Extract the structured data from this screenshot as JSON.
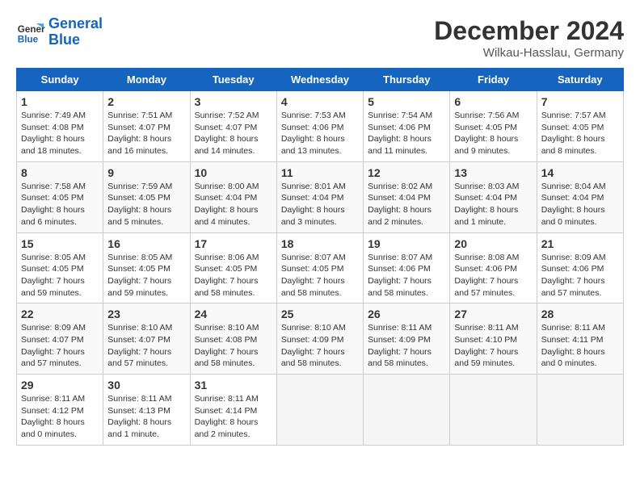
{
  "header": {
    "logo_line1": "General",
    "logo_line2": "Blue",
    "month": "December 2024",
    "location": "Wilkau-Hasslau, Germany"
  },
  "days_of_week": [
    "Sunday",
    "Monday",
    "Tuesday",
    "Wednesday",
    "Thursday",
    "Friday",
    "Saturday"
  ],
  "weeks": [
    [
      {
        "num": "1",
        "detail": "Sunrise: 7:49 AM\nSunset: 4:08 PM\nDaylight: 8 hours\nand 18 minutes."
      },
      {
        "num": "2",
        "detail": "Sunrise: 7:51 AM\nSunset: 4:07 PM\nDaylight: 8 hours\nand 16 minutes."
      },
      {
        "num": "3",
        "detail": "Sunrise: 7:52 AM\nSunset: 4:07 PM\nDaylight: 8 hours\nand 14 minutes."
      },
      {
        "num": "4",
        "detail": "Sunrise: 7:53 AM\nSunset: 4:06 PM\nDaylight: 8 hours\nand 13 minutes."
      },
      {
        "num": "5",
        "detail": "Sunrise: 7:54 AM\nSunset: 4:06 PM\nDaylight: 8 hours\nand 11 minutes."
      },
      {
        "num": "6",
        "detail": "Sunrise: 7:56 AM\nSunset: 4:05 PM\nDaylight: 8 hours\nand 9 minutes."
      },
      {
        "num": "7",
        "detail": "Sunrise: 7:57 AM\nSunset: 4:05 PM\nDaylight: 8 hours\nand 8 minutes."
      }
    ],
    [
      {
        "num": "8",
        "detail": "Sunrise: 7:58 AM\nSunset: 4:05 PM\nDaylight: 8 hours\nand 6 minutes."
      },
      {
        "num": "9",
        "detail": "Sunrise: 7:59 AM\nSunset: 4:05 PM\nDaylight: 8 hours\nand 5 minutes."
      },
      {
        "num": "10",
        "detail": "Sunrise: 8:00 AM\nSunset: 4:04 PM\nDaylight: 8 hours\nand 4 minutes."
      },
      {
        "num": "11",
        "detail": "Sunrise: 8:01 AM\nSunset: 4:04 PM\nDaylight: 8 hours\nand 3 minutes."
      },
      {
        "num": "12",
        "detail": "Sunrise: 8:02 AM\nSunset: 4:04 PM\nDaylight: 8 hours\nand 2 minutes."
      },
      {
        "num": "13",
        "detail": "Sunrise: 8:03 AM\nSunset: 4:04 PM\nDaylight: 8 hours\nand 1 minute."
      },
      {
        "num": "14",
        "detail": "Sunrise: 8:04 AM\nSunset: 4:04 PM\nDaylight: 8 hours\nand 0 minutes."
      }
    ],
    [
      {
        "num": "15",
        "detail": "Sunrise: 8:05 AM\nSunset: 4:05 PM\nDaylight: 7 hours\nand 59 minutes."
      },
      {
        "num": "16",
        "detail": "Sunrise: 8:05 AM\nSunset: 4:05 PM\nDaylight: 7 hours\nand 59 minutes."
      },
      {
        "num": "17",
        "detail": "Sunrise: 8:06 AM\nSunset: 4:05 PM\nDaylight: 7 hours\nand 58 minutes."
      },
      {
        "num": "18",
        "detail": "Sunrise: 8:07 AM\nSunset: 4:05 PM\nDaylight: 7 hours\nand 58 minutes."
      },
      {
        "num": "19",
        "detail": "Sunrise: 8:07 AM\nSunset: 4:06 PM\nDaylight: 7 hours\nand 58 minutes."
      },
      {
        "num": "20",
        "detail": "Sunrise: 8:08 AM\nSunset: 4:06 PM\nDaylight: 7 hours\nand 57 minutes."
      },
      {
        "num": "21",
        "detail": "Sunrise: 8:09 AM\nSunset: 4:06 PM\nDaylight: 7 hours\nand 57 minutes."
      }
    ],
    [
      {
        "num": "22",
        "detail": "Sunrise: 8:09 AM\nSunset: 4:07 PM\nDaylight: 7 hours\nand 57 minutes."
      },
      {
        "num": "23",
        "detail": "Sunrise: 8:10 AM\nSunset: 4:07 PM\nDaylight: 7 hours\nand 57 minutes."
      },
      {
        "num": "24",
        "detail": "Sunrise: 8:10 AM\nSunset: 4:08 PM\nDaylight: 7 hours\nand 58 minutes."
      },
      {
        "num": "25",
        "detail": "Sunrise: 8:10 AM\nSunset: 4:09 PM\nDaylight: 7 hours\nand 58 minutes."
      },
      {
        "num": "26",
        "detail": "Sunrise: 8:11 AM\nSunset: 4:09 PM\nDaylight: 7 hours\nand 58 minutes."
      },
      {
        "num": "27",
        "detail": "Sunrise: 8:11 AM\nSunset: 4:10 PM\nDaylight: 7 hours\nand 59 minutes."
      },
      {
        "num": "28",
        "detail": "Sunrise: 8:11 AM\nSunset: 4:11 PM\nDaylight: 8 hours\nand 0 minutes."
      }
    ],
    [
      {
        "num": "29",
        "detail": "Sunrise: 8:11 AM\nSunset: 4:12 PM\nDaylight: 8 hours\nand 0 minutes."
      },
      {
        "num": "30",
        "detail": "Sunrise: 8:11 AM\nSunset: 4:13 PM\nDaylight: 8 hours\nand 1 minute."
      },
      {
        "num": "31",
        "detail": "Sunrise: 8:11 AM\nSunset: 4:14 PM\nDaylight: 8 hours\nand 2 minutes."
      },
      null,
      null,
      null,
      null
    ]
  ]
}
